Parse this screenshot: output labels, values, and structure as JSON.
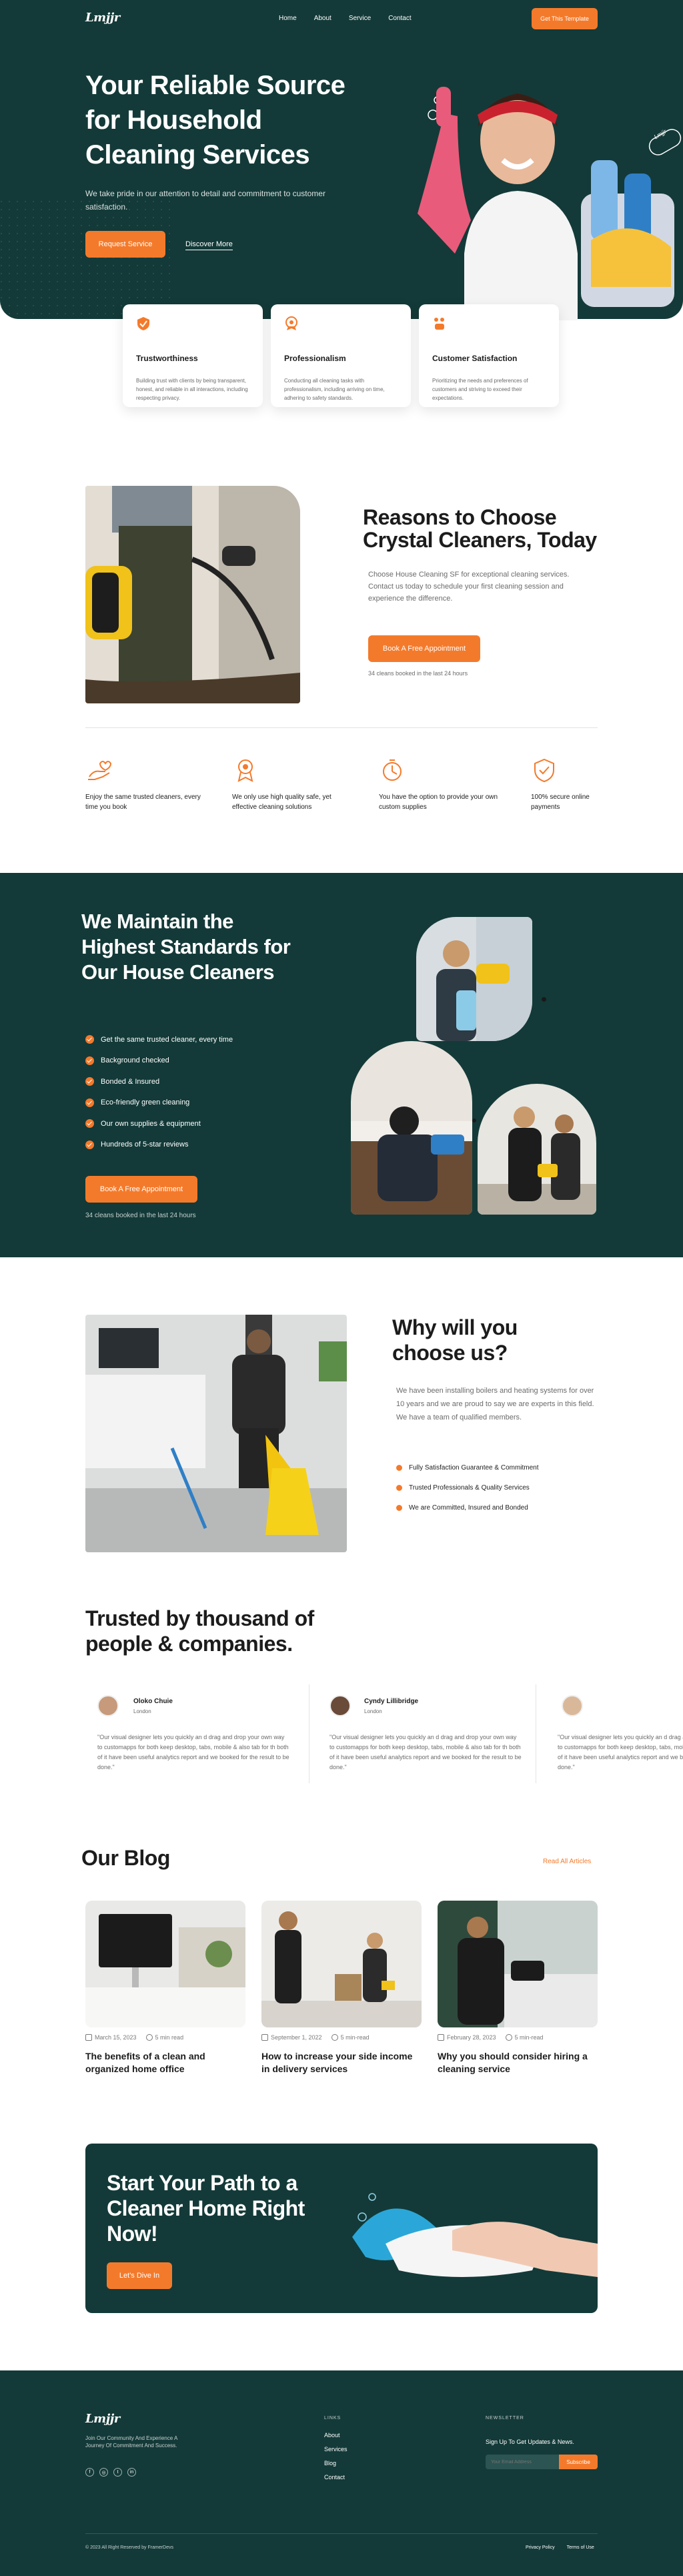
{
  "brand": {
    "logo": "Lmjjr",
    "accent": "#f47a2b",
    "dark": "#133a38"
  },
  "nav": {
    "items": [
      "Home",
      "About",
      "Service",
      "Contact"
    ],
    "cta": "Get This Template"
  },
  "hero": {
    "title": "Your Reliable Source for Household Cleaning Services",
    "subtitle": "We take pride in our attention to detail and commitment to customer satisfaction.",
    "primary": "Request Service",
    "secondary": "Discover More",
    "badge": "Lmjjr"
  },
  "features": [
    {
      "title": "Trustworthiness",
      "text": "Building trust with clients by being transparent, honest, and reliable in all interactions, including respecting privacy.",
      "icon": "shield-check-icon"
    },
    {
      "title": "Professionalism",
      "text": "Conducting all cleaning tasks with professionalism, including arriving on time, adhering to safety standards.",
      "icon": "badge-icon"
    },
    {
      "title": "Customer Satisfaction",
      "text": "Prioritizing the needs and preferences of customers and striving to exceed their expectations.",
      "icon": "smile-hand-icon"
    }
  ],
  "reasons": {
    "title": "Reasons to Choose Crystal Cleaners, Today",
    "text": "Choose House Cleaning SF for exceptional cleaning services. Contact us today to schedule your first cleaning session and experience the difference.",
    "button": "Book A Free Appointment",
    "note": "34 cleans booked in the last 24 hours",
    "items": [
      {
        "text": "Enjoy the same trusted cleaners, every time you book",
        "icon": "hand-heart-icon"
      },
      {
        "text": "We only use high quality safe, yet effective cleaning solutions",
        "icon": "award-icon"
      },
      {
        "text": "You have the option to provide your own custom supplies",
        "icon": "timer-icon"
      },
      {
        "text": "100% secure online payments",
        "icon": "shield-icon"
      }
    ]
  },
  "standards": {
    "title": "We Maintain the Highest Standards for Our House Cleaners",
    "items": [
      "Get the same trusted cleaner, every time",
      "Background checked",
      "Bonded & Insured",
      "Eco-friendly green cleaning",
      "Our own supplies & equipment",
      "Hundreds of 5-star reviews"
    ],
    "button": "Book A Free Appointment",
    "note": "34 cleans booked in the last 24 hours"
  },
  "why": {
    "title": "Why will you choose us?",
    "text": "We have been installing boilers and heating systems for over 10 years and we are proud to say we are experts in this field. We have a team of qualified members.",
    "items": [
      "Fully Satisfaction Guarantee & Commitment",
      "Trusted Professionals & Quality Services",
      "We are Committed, Insured and Bonded"
    ]
  },
  "testimonials": {
    "title": "Trusted by thousand of people & companies.",
    "items": [
      {
        "name": "Oloko Chuie",
        "city": "London",
        "text": "\"Our visual designer lets you quickly an d drag and drop your own way to customapps for both keep desktop, tabs, mobile & also tab for th both of it have been useful analytics report and we booked for the result to be done.\""
      },
      {
        "name": "Cyndy Lillibridge",
        "city": "London",
        "text": "\"Our visual designer lets you quickly an d drag and drop your own way to customapps for both keep desktop, tabs, mobile & also tab for th both of it have been useful analytics report and we booked for the result to be done.\""
      },
      {
        "name": "",
        "city": "",
        "text": "\"Our visual designer lets you quickly an d drag and drop your own way to customapps for both keep desktop, tabs, mobile & also tab for th both of it have been useful analytics report and we booked for the result to be done.\""
      }
    ]
  },
  "blog": {
    "title": "Our Blog",
    "link": "Read All Articles",
    "posts": [
      {
        "date": "March 15, 2023",
        "read": "5 min read",
        "title": "The benefits of a clean and organized home office"
      },
      {
        "date": "September 1, 2022",
        "read": "5 min-read",
        "title": "How to increase your side income in delivery services"
      },
      {
        "date": "February 28, 2023",
        "read": "5 min-read",
        "title": "Why you should consider hiring a cleaning service"
      }
    ]
  },
  "cta": {
    "title": "Start Your Path to a Cleaner Home Right Now!",
    "button": "Let's Dive In"
  },
  "footer": {
    "logo": "Lmjjr",
    "tagline": "Join Our Community And Experience A Journey Of Commitment And Success.",
    "links_title": "LINKS",
    "links": [
      "About",
      "Services",
      "Blog",
      "Contact"
    ],
    "newsletter_title": "NEWSLETTER",
    "newsletter_text": "Sign Up To Get Updates & News.",
    "email_placeholder": "Your Email Address",
    "subscribe": "Subscribe",
    "copyright": "© 2023 All Right Reserved by FramerDevs",
    "legal": [
      "Privacy Policy",
      "Terms of Use"
    ],
    "social": [
      "facebook-icon",
      "instagram-icon",
      "twitter-icon",
      "linkedin-icon"
    ]
  }
}
